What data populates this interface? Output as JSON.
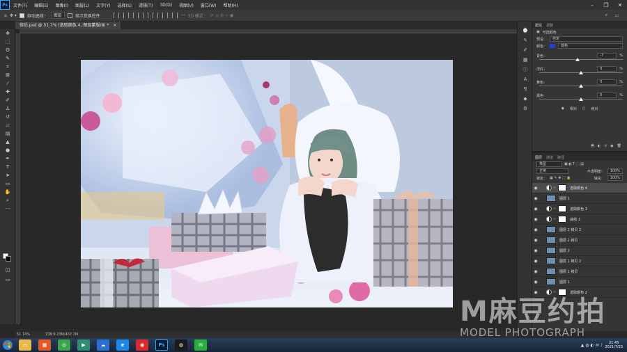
{
  "menubar": {
    "logo": "Ps",
    "items": [
      "文件(F)",
      "编辑(E)",
      "图像(I)",
      "图层(L)",
      "文字(Y)",
      "选择(S)",
      "滤镜(T)",
      "3D(D)",
      "视图(V)",
      "窗口(W)",
      "帮助(H)"
    ]
  },
  "options": {
    "auto_select": "自动选择：",
    "auto_select_value": "图层",
    "show_transform": "显示变换控件",
    "mode_3d": "3D 模式："
  },
  "document": {
    "tab_title": "修后.psd @ 51.7% (选取颜色 4, 图层蒙版/8) *",
    "close": "×"
  },
  "status": {
    "zoom": "51.74%",
    "doc_size": "文档:9.23M/407.7M"
  },
  "properties": {
    "tab_props": "属性",
    "tab_adjust": "调整",
    "panel_title": "可选颜色",
    "preset_label": "预设：",
    "preset_value": "自定",
    "colors_label": "颜色：",
    "colors_value": "蓝色",
    "sliders": [
      {
        "label": "青色：",
        "value": "-7",
        "unit": "%",
        "position": 0.46
      },
      {
        "label": "洋红：",
        "value": "0",
        "unit": "%",
        "position": 0.5
      },
      {
        "label": "黄色：",
        "value": "0",
        "unit": "%",
        "position": 0.5
      },
      {
        "label": "黑色：",
        "value": "0",
        "unit": "%",
        "position": 0.5
      }
    ],
    "method_relative": "相对",
    "method_absolute": "绝对"
  },
  "layers": {
    "tabs": [
      "图层",
      "通道",
      "路径"
    ],
    "filter_kind": "类型",
    "blend_mode": "正常",
    "opacity_label": "不透明度：",
    "opacity": "100%",
    "lock_label": "锁定：",
    "fill_label": "填充：",
    "fill": "100%",
    "rows": [
      {
        "name": "选取颜色 4",
        "kind": "adjust",
        "selected": true
      },
      {
        "name": "图层 1",
        "kind": "pixel",
        "selected": false
      },
      {
        "name": "选取颜色 3",
        "kind": "adjust",
        "selected": false
      },
      {
        "name": "曲线 1",
        "kind": "adjust",
        "selected": false
      },
      {
        "name": "图层 2 拷贝 2",
        "kind": "pixel",
        "selected": false
      },
      {
        "name": "图层 2 拷贝",
        "kind": "pixel",
        "selected": false
      },
      {
        "name": "图层 2",
        "kind": "pixel",
        "selected": false
      },
      {
        "name": "图层 1 拷贝 2",
        "kind": "pixel",
        "selected": false
      },
      {
        "name": "图层 1 拷贝",
        "kind": "pixel",
        "selected": false
      },
      {
        "name": "图层 1",
        "kind": "pixel",
        "selected": false
      },
      {
        "name": "选取颜色 2",
        "kind": "adjust",
        "selected": false
      }
    ]
  },
  "taskbar": {
    "clock_time": "21:45",
    "clock_date": "2021/7/23"
  },
  "watermark": {
    "logo": "M麻豆约拍",
    "sub": "MODEL PHOTOGRAPH"
  }
}
